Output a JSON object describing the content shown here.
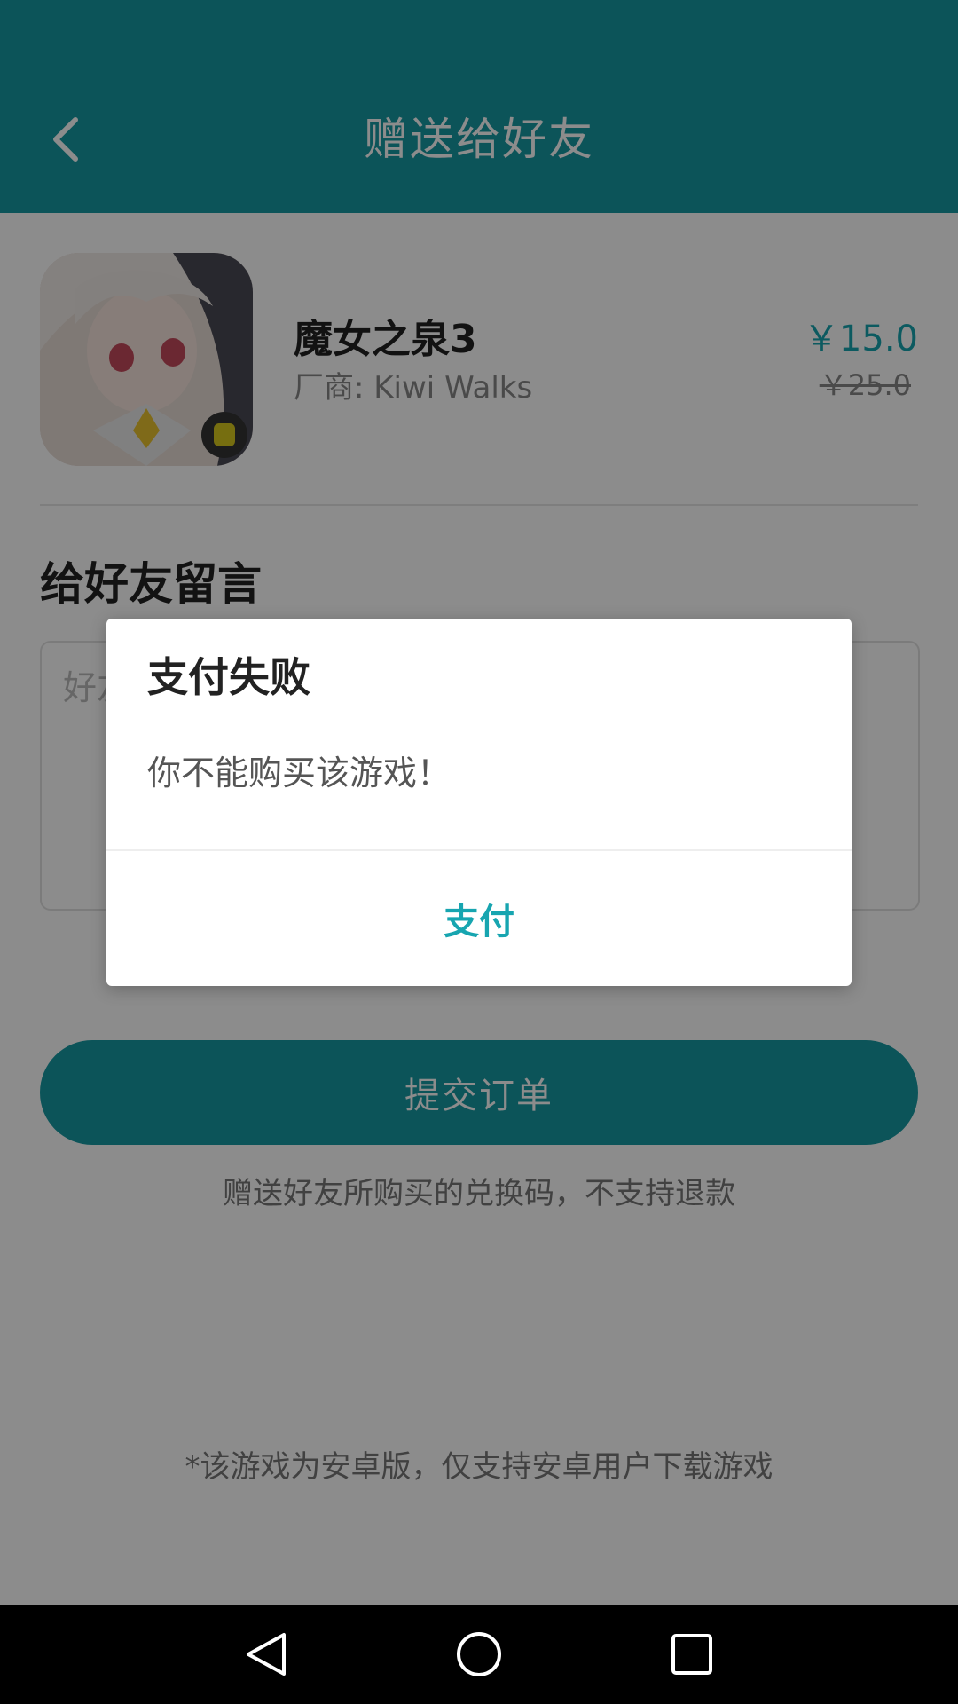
{
  "header": {
    "title": "赠送给好友"
  },
  "game": {
    "name": "魔女之泉3",
    "vendor": "厂商: Kiwi Walks",
    "price_current": "￥15.0",
    "price_original": "￥25.0"
  },
  "message": {
    "section_title": "给好友留言",
    "placeholder": "好友"
  },
  "submit": {
    "label": "提交订单"
  },
  "notes": {
    "refund": "赠送好友所购买的兑换码，不支持退款",
    "android": "*该游戏为安卓版，仅支持安卓用户下载游戏"
  },
  "dialog": {
    "title": "支付失败",
    "message": "你不能购买该游戏！",
    "button": "支付"
  },
  "colors": {
    "accent": "#169aa3",
    "price": "#17a5b0"
  },
  "icons": {
    "back": "chevron-left-icon",
    "nav_back": "triangle-back-icon",
    "nav_home": "circle-home-icon",
    "nav_recent": "square-recent-icon"
  }
}
